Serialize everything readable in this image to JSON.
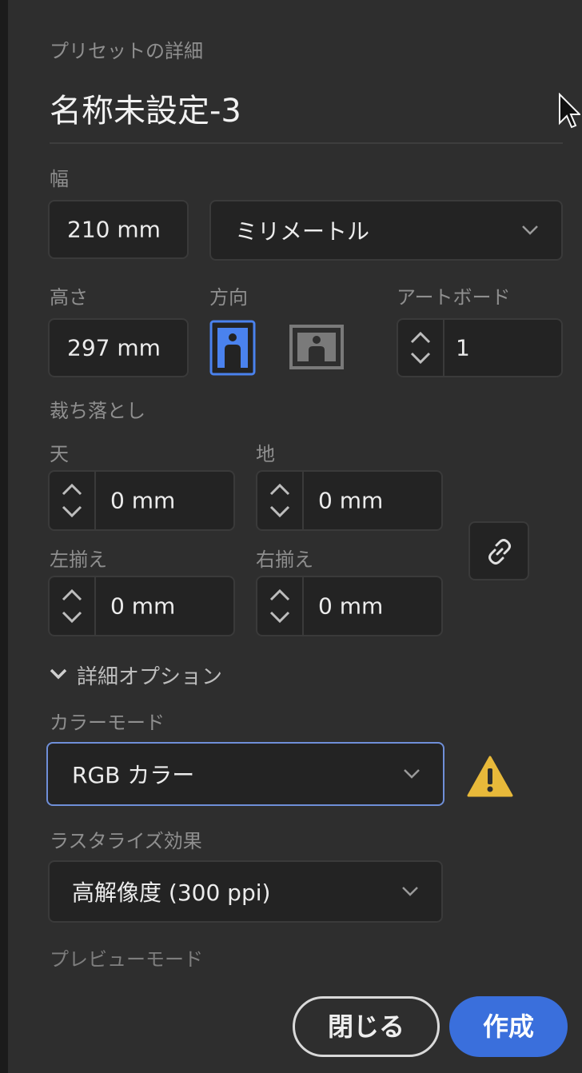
{
  "panel": {
    "heading": "プリセットの詳細",
    "preset_name": "名称未設定-3"
  },
  "width": {
    "label": "幅",
    "value": "210 mm",
    "unit": "ミリメートル"
  },
  "height": {
    "label": "高さ",
    "value": "297 mm"
  },
  "orientation": {
    "label": "方向",
    "selected": "portrait"
  },
  "artboards": {
    "label": "アートボード",
    "value": "1"
  },
  "bleed": {
    "label": "裁ち落とし",
    "top_label": "天",
    "top_value": "0 mm",
    "bottom_label": "地",
    "bottom_value": "0 mm",
    "left_label": "左揃え",
    "left_value": "0 mm",
    "right_label": "右揃え",
    "right_value": "0 mm"
  },
  "advanced": {
    "toggle_label": "詳細オプション",
    "color_mode_label": "カラーモード",
    "color_mode_value": "RGB カラー",
    "raster_label": "ラスタライズ効果",
    "raster_value": "高解像度 (300 ppi)",
    "preview_label": "プレビューモード"
  },
  "buttons": {
    "close": "閉じる",
    "create": "作成"
  },
  "colors": {
    "background": "#2e2e2e",
    "field": "#232323",
    "accent": "#3a6fdc",
    "focus_border": "#6f8fd8",
    "warning": "#e8b93a"
  },
  "icons": {
    "portrait": "portrait-orientation-icon",
    "landscape": "landscape-orientation-icon",
    "link": "link-icon",
    "warning": "warning-icon",
    "cursor": "mouse-cursor-icon"
  }
}
